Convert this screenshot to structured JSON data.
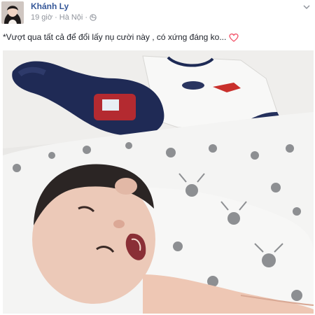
{
  "post": {
    "author": "Khánh Ly",
    "time": "19 giờ",
    "separator": "·",
    "location": "Hà Nội",
    "caption": "*Vượt qua tất cả để đổi lấy nụ cười này , có xứng đáng ko...",
    "caption_emoji": "heart-icon"
  },
  "colors": {
    "link": "#365899",
    "meta": "#90949c",
    "text": "#1d2129",
    "heart": "#f25268"
  },
  "icons": {
    "privacy": "globe-icon",
    "menu": "chevron-down-icon"
  }
}
